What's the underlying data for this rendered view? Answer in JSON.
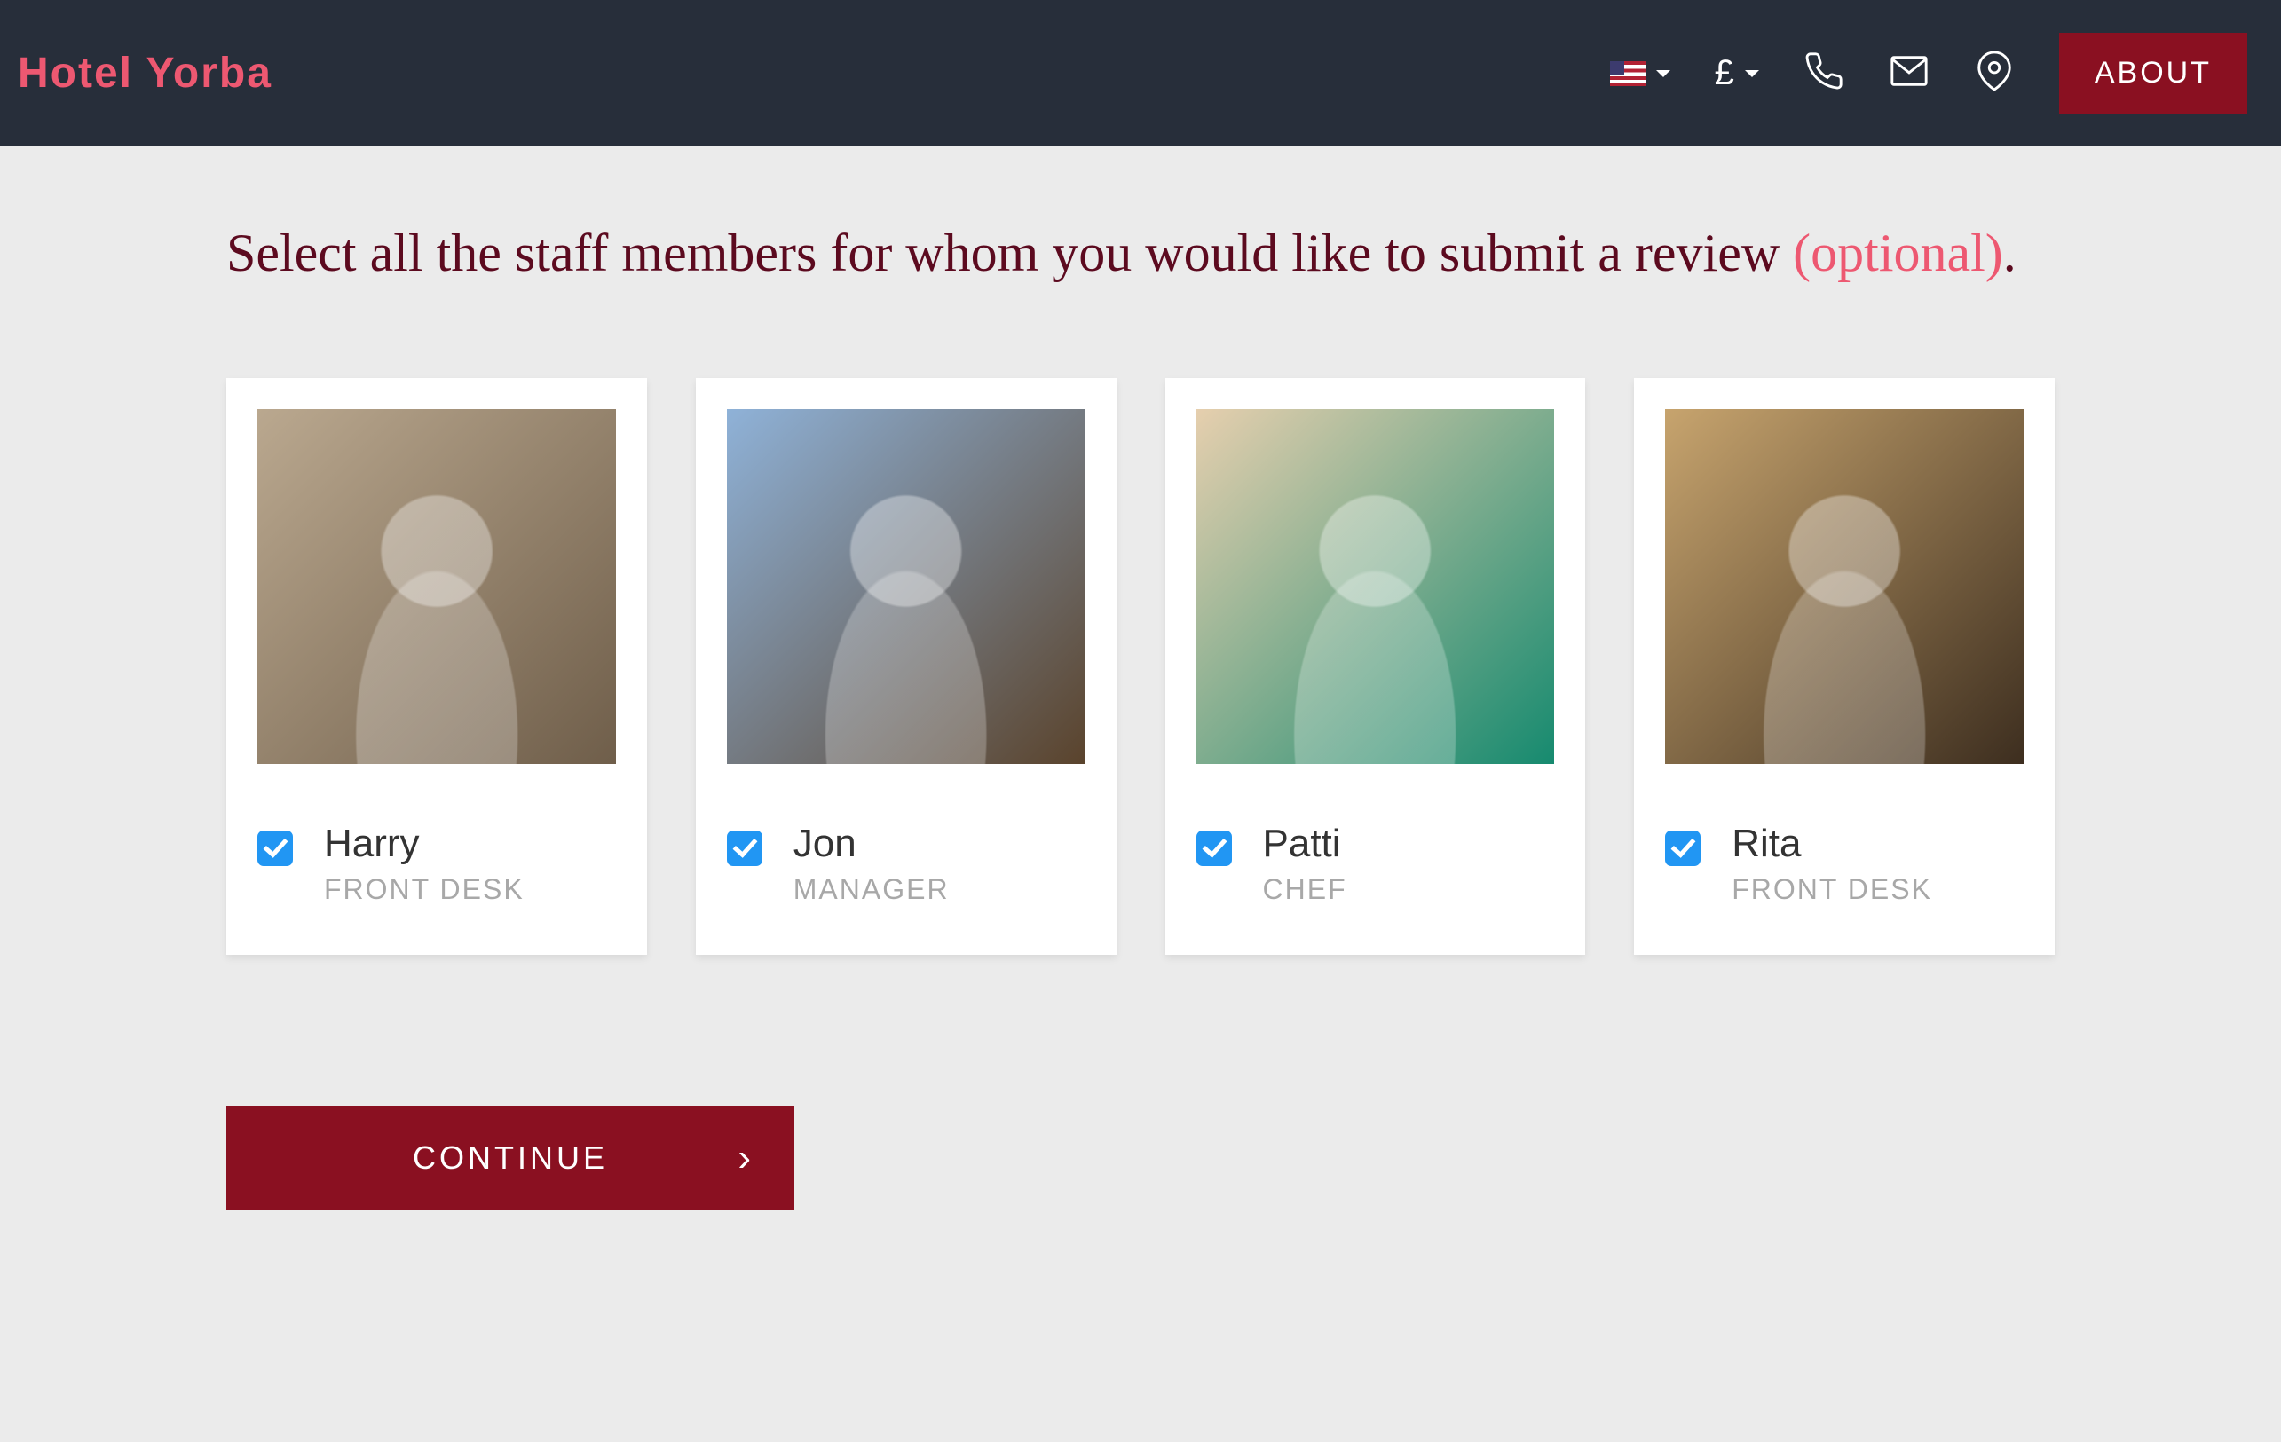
{
  "header": {
    "logo": "Hotel Yorba",
    "language_icon": "us-flag",
    "currency": "£",
    "about_label": "ABOUT"
  },
  "prompt": {
    "text_before": "Select all the staff members for whom you would like to submit a review ",
    "optional_text": "(optional)",
    "text_after": "."
  },
  "staff": [
    {
      "name": "Harry",
      "role": "FRONT DESK",
      "checked": true
    },
    {
      "name": "Jon",
      "role": "MANAGER",
      "checked": true
    },
    {
      "name": "Patti",
      "role": "CHEF",
      "checked": true
    },
    {
      "name": "Rita",
      "role": "FRONT DESK",
      "checked": true
    }
  ],
  "continue_label": "CONTINUE"
}
